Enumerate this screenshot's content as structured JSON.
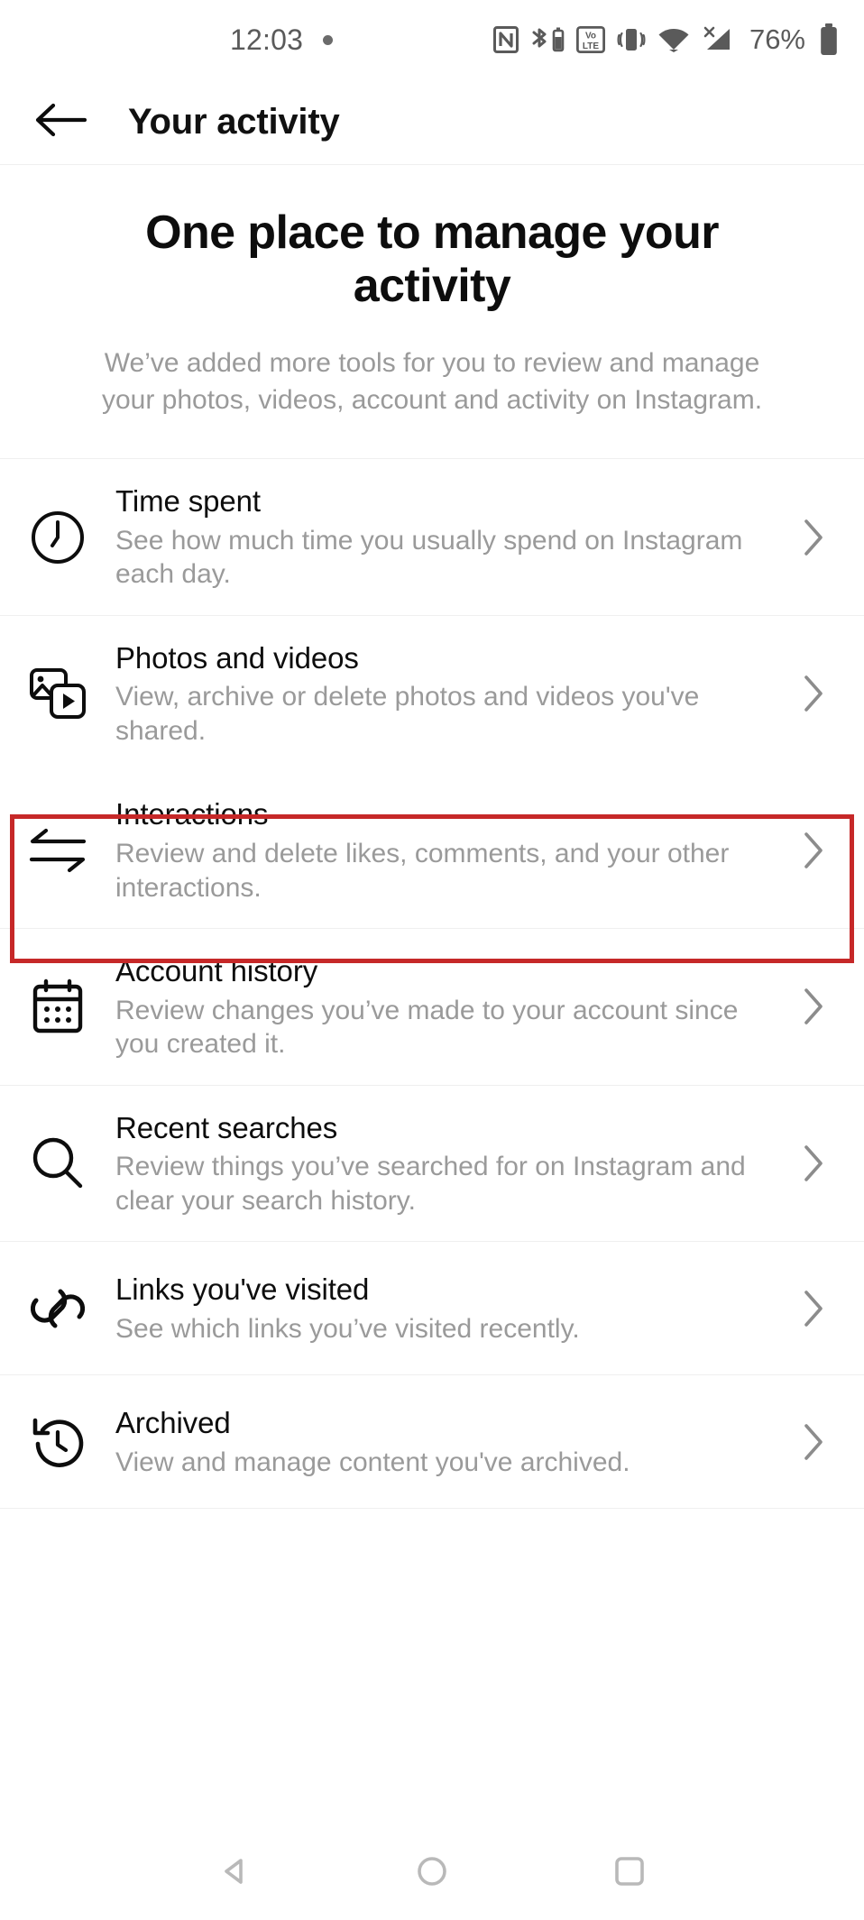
{
  "status_bar": {
    "time": "12:03",
    "battery_percent": "76%",
    "icons": [
      "notification-dot-icon",
      "nfc-icon",
      "bluetooth-battery-icon",
      "volte-icon",
      "vibrate-icon",
      "wifi-icon",
      "cellular-no-sim-icon",
      "battery-icon"
    ]
  },
  "appbar": {
    "title": "Your activity",
    "back_icon": "back-arrow-icon"
  },
  "hero": {
    "title": "One place to manage your activity",
    "subtitle": "We’ve added more tools for you to review and manage your photos, videos, account and activity on Instagram."
  },
  "list": {
    "items": [
      {
        "icon": "clock-icon",
        "title": "Time spent",
        "desc": "See how much time you usually spend on Instagram each day.",
        "highlighted": false
      },
      {
        "icon": "photos-videos-icon",
        "title": "Photos and videos",
        "desc": "View, archive or delete photos and videos you've shared.",
        "highlighted": true
      },
      {
        "icon": "interactions-arrows-icon",
        "title": "Interactions",
        "desc": "Review and delete likes, comments, and your other interactions.",
        "highlighted": false
      },
      {
        "icon": "calendar-icon",
        "title": "Account history",
        "desc": "Review changes you’ve made to your account since you created it.",
        "highlighted": false
      },
      {
        "icon": "search-icon",
        "title": "Recent searches",
        "desc": "Review things you’ve searched for on Instagram and clear your search history.",
        "highlighted": false
      },
      {
        "icon": "link-icon",
        "title": "Links you've visited",
        "desc": "See which links you’ve visited recently.",
        "highlighted": false
      },
      {
        "icon": "archive-restore-icon",
        "title": "Archived",
        "desc": "View and manage content you've archived.",
        "highlighted": false
      }
    ],
    "chevron_icon": "chevron-right-icon"
  },
  "navbar": {
    "back": "nav-back-triangle-icon",
    "home": "nav-home-circle-icon",
    "recents": "nav-recents-square-icon"
  },
  "colors": {
    "highlight_border": "#c62828",
    "title_text": "#0d0d0d",
    "desc_text": "#9a9a9a",
    "divider": "#efefef",
    "chevron": "#8c8c8c"
  }
}
